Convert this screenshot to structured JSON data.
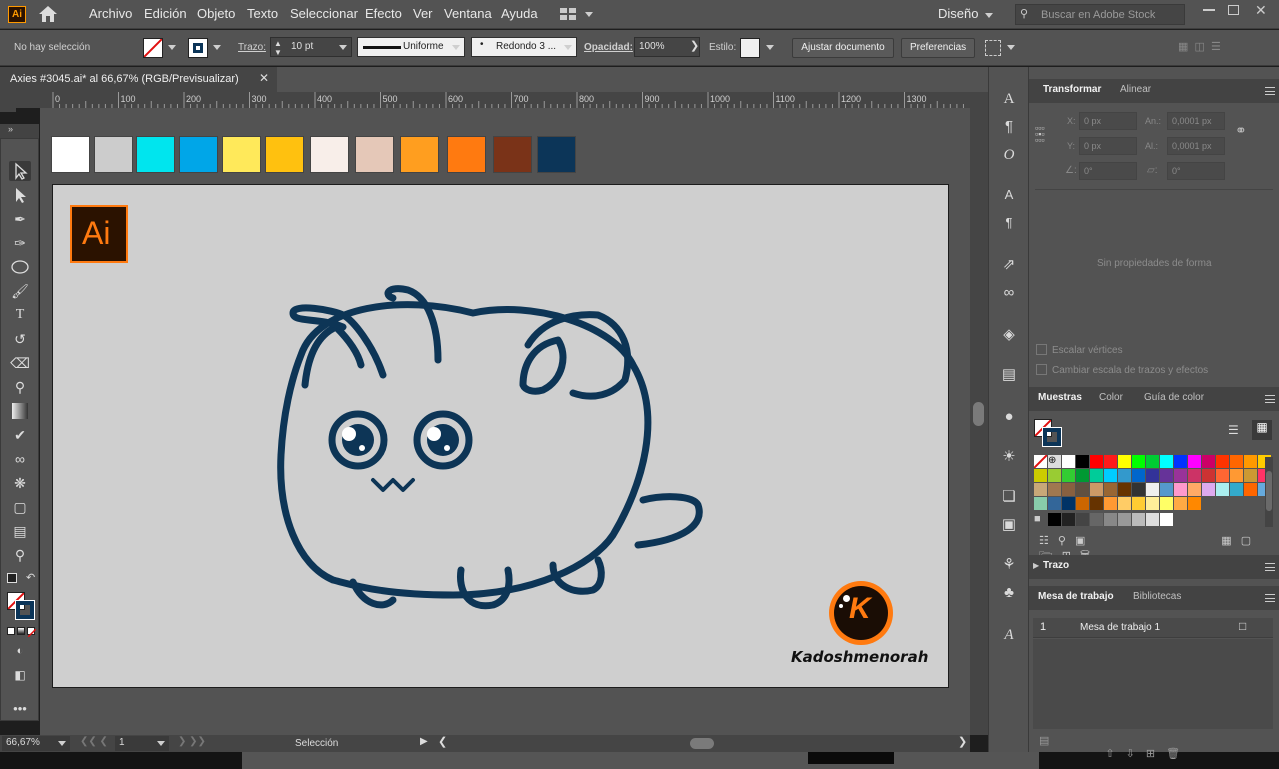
{
  "app": {
    "logo": "Ai",
    "workspace": "Diseño",
    "stock_placeholder": "Buscar en Adobe Stock"
  },
  "menu": [
    "Archivo",
    "Edición",
    "Objeto",
    "Texto",
    "Seleccionar",
    "Efecto",
    "Ver",
    "Ventana",
    "Ayuda"
  ],
  "control": {
    "selection": "No hay selección",
    "stroke_label": "Trazo:",
    "stroke_value": "10 pt",
    "profile": "Uniforme",
    "brush": "Redondo 3 ...",
    "opacity_label": "Opacidad:",
    "opacity_value": "100%",
    "style_label": "Estilo:",
    "adjust_button": "Ajustar documento",
    "prefs_button": "Preferencias"
  },
  "document": {
    "tab_title": "Axies #3045.ai* al 66,67% (RGB/Previsualizar)"
  },
  "ruler": {
    "ticks": [
      "0",
      "100",
      "200",
      "300",
      "400",
      "500",
      "600",
      "700",
      "800",
      "900",
      "1000",
      "1100",
      "1200",
      "1300"
    ]
  },
  "palette": [
    "#ffffff",
    "#cccccc",
    "#00e5ee",
    "#00a6e8",
    "#ffe95a",
    "#ffc10f",
    "#f8eee9",
    "#e5c8b8",
    "#ff9e1f",
    "#ff7a10",
    "#7a3318",
    "#0c3558"
  ],
  "artwork": {
    "brand": "Kadoshmenorah",
    "brand_letter": "K",
    "badge_text": "Ai",
    "stroke_color": "#0d3556"
  },
  "status": {
    "zoom": "66,67%",
    "artboard_num": "1",
    "tool_label": "Selección"
  },
  "transform_panel": {
    "tabs": [
      "Transformar",
      "Alinear"
    ],
    "x_label": "X:",
    "x_val": "0 px",
    "w_label": "An.:",
    "w_val": "0,0001 px",
    "y_label": "Y:",
    "y_val": "0 px",
    "h_label": "Al.:",
    "h_val": "0,0001 px",
    "angle_val": "0°",
    "shear_val": "0°",
    "empty_msg": "Sin propiedades de forma",
    "cb1": "Escalar vértices",
    "cb2": "Cambiar escala de trazos y efectos"
  },
  "swatches_panel": {
    "tabs": [
      "Muestras",
      "Color",
      "Guía de color"
    ]
  },
  "stroke_panel": {
    "title": "Trazo"
  },
  "artboards_panel": {
    "tabs": [
      "Mesa de trabajo",
      "Bibliotecas"
    ],
    "row_num": "1",
    "row_name": "Mesa de trabajo 1"
  }
}
